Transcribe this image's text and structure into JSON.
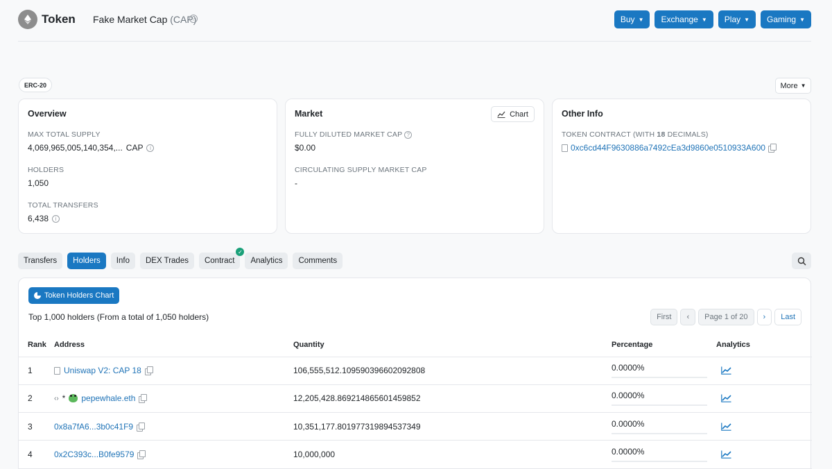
{
  "header": {
    "token_word": "Token",
    "token_name": "Fake Market Cap",
    "token_symbol": "(CAP)",
    "buttons": [
      "Buy",
      "Exchange",
      "Play",
      "Gaming"
    ]
  },
  "badge": "ERC-20",
  "more_label": "More",
  "overview": {
    "title": "Overview",
    "max_supply_label": "MAX TOTAL SUPPLY",
    "max_supply_value": "4,069,965,005,140,354,...",
    "max_supply_unit": "CAP",
    "holders_label": "HOLDERS",
    "holders_value": "1,050",
    "transfers_label": "TOTAL TRANSFERS",
    "transfers_value": "6,438"
  },
  "market": {
    "title": "Market",
    "chart_label": "Chart",
    "fdmc_label": "FULLY DILUTED MARKET CAP",
    "fdmc_value": "$0.00",
    "csmc_label": "CIRCULATING SUPPLY MARKET CAP",
    "csmc_value": "-"
  },
  "other_info": {
    "title": "Other Info",
    "contract_label_prefix": "TOKEN CONTRACT (WITH ",
    "contract_decimals": "18",
    "contract_label_suffix": " DECIMALS)",
    "contract_address": "0xc6cd44F9630886a7492cEa3d9860e0510933A600"
  },
  "tabs": [
    "Transfers",
    "Holders",
    "Info",
    "DEX Trades",
    "Contract",
    "Analytics",
    "Comments"
  ],
  "active_tab": "Holders",
  "holders": {
    "chart_button": "Token Holders Chart",
    "summary": "Top 1,000 holders (From a total of 1,050 holders)",
    "pager": {
      "first": "First",
      "prev": "‹",
      "page": "Page 1 of 20",
      "next": "›",
      "last": "Last"
    },
    "columns": [
      "Rank",
      "Address",
      "Quantity",
      "Percentage",
      "Analytics"
    ],
    "rows": [
      {
        "rank": "1",
        "address": "Uniswap V2: CAP 18",
        "quantity": "106,555,512.109590396602092808",
        "percentage": "0.0000%"
      },
      {
        "rank": "2",
        "address": "pepewhale.eth",
        "quantity": "12,205,428.869214865601459852",
        "percentage": "0.0000%"
      },
      {
        "rank": "3",
        "address": "0x8a7fA6...3b0c41F9",
        "quantity": "10,351,177.801977319894537349",
        "percentage": "0.0000%"
      },
      {
        "rank": "4",
        "address": "0x2C393c...B0fe9579",
        "quantity": "10,000,000",
        "percentage": "0.0000%"
      }
    ]
  },
  "colors": {
    "primary": "#1a78c2",
    "link": "#1f73b7",
    "success": "#1aa079"
  }
}
